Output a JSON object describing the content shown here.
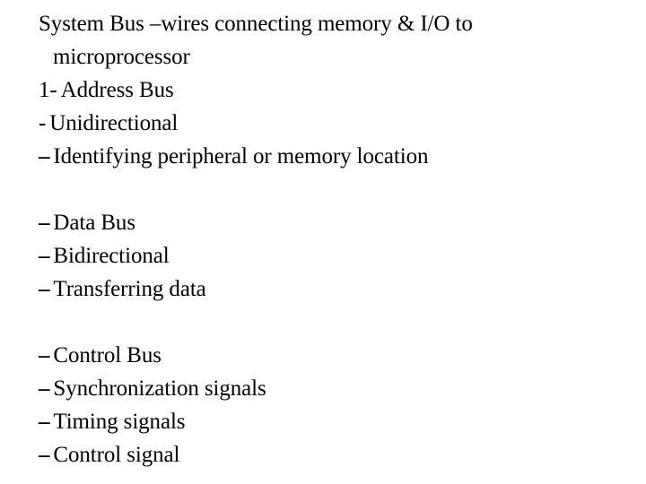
{
  "slide": {
    "background_color": "#ffffff",
    "text_color": "#000000",
    "heading_line_1": "System   Bus   –wires   connecting   memory   &   I/O   to",
    "heading_line_2": "microprocessor",
    "blocks": [
      {
        "id": "address-bus",
        "lines": [
          {
            "marker": "1-",
            "marker_type": "hyphen",
            "text": "Address Bus"
          },
          {
            "marker": "-",
            "marker_type": "hyphen",
            "text": "Unidirectional"
          },
          {
            "marker": "–",
            "marker_type": "endash",
            "text": "Identifying peripheral or memory location"
          }
        ]
      },
      {
        "id": "data-bus",
        "lines": [
          {
            "marker": "–",
            "marker_type": "endash",
            "text": "Data Bus"
          },
          {
            "marker": "–",
            "marker_type": "endash",
            "text": "Bidirectional"
          },
          {
            "marker": "–",
            "marker_type": "endash",
            "text": "Transferring data"
          }
        ]
      },
      {
        "id": "control-bus",
        "lines": [
          {
            "marker": "–",
            "marker_type": "endash",
            "text": "Control Bus"
          },
          {
            "marker": "–",
            "marker_type": "endash",
            "text": "Synchronization signals"
          },
          {
            "marker": "–",
            "marker_type": "endash",
            "text": "Timing signals"
          },
          {
            "marker": "–",
            "marker_type": "endash",
            "text": "Control signal"
          }
        ]
      }
    ]
  }
}
